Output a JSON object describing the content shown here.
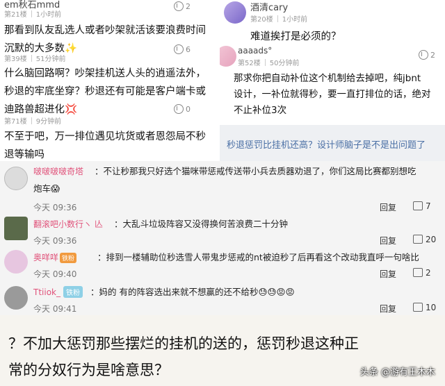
{
  "left_panel": {
    "comments": [
      {
        "username": "em秋石mmd",
        "floor": "第21楼",
        "time": "1小时前",
        "likes": "2",
        "lines": [
          "那看到队友乱选人或者吵架就活该要浪费时间",
          "沉默的大多数✨"
        ]
      },
      {
        "username": "",
        "floor": "第39楼",
        "time": "51分钟前",
        "likes": "6",
        "lines": [
          "什么脑回路啊？吵架挂机送人头的逍遥法外，",
          "秒退的牢底坐穿？秒退还有可能是客户端卡或",
          "迪路兽超进化💢"
        ]
      },
      {
        "username": "",
        "floor": "第71楼",
        "time": "9分钟前",
        "likes": "0",
        "lines": [
          "不至于吧，万一排位遇见坑货或者恩怨局不秒",
          "退等输吗"
        ]
      }
    ]
  },
  "right_panel": {
    "comments": [
      {
        "username": "酒清cary",
        "floor": "第20楼",
        "time": "1小时前",
        "likes": "",
        "lines": [
          "难道挨打是必须的？"
        ]
      },
      {
        "username": "aaaads°",
        "floor": "第52楼",
        "time": "50分钟前",
        "likes": "2",
        "lines": [
          "那求你把自动补位这个机制给去掉吧，纯jbnt",
          "设计，一补位就得秒，要一直打排位的话，绝对",
          "不止补位3次"
        ]
      }
    ],
    "strip_text": "秒退惩罚比挂机还高？设计师脑子是不是出问题了"
  },
  "bottom_panel": {
    "reply_label": "回复",
    "comments": [
      {
        "name": "啵啵啵啵奇塔",
        "badge": "",
        "text": [
          "：不让秒那我只好选个猫咪带惩戒传送带小兵去质器劝退了，你们这局比赛都别想吃",
          "炮车😱"
        ],
        "time": "今天 09:36",
        "likes": "7",
        "avatar_color": "#d9d9d9"
      },
      {
        "name": "翻滚吧小数行ヽ 亾",
        "badge": "",
        "text": [
          "：大乱斗垃圾阵容又没得换何苦浪费二十分钟"
        ],
        "time": "今天 09:36",
        "likes": "20",
        "avatar_color": "#5a6a4a"
      },
      {
        "name": "奥咩咩",
        "badge": "铁粉",
        "text": [
          "：排到一楼辅助位秒选雪人带鬼步惩戒的nt被迫秒了后再看这个改动我直呼一句啥比"
        ],
        "time": "今天 09:40",
        "likes": "2",
        "avatar_color": "#e7c6e0"
      },
      {
        "name": "Ttiiok_",
        "badge": "铁粉",
        "text": [
          "：妈的 有的阵容选出来就不想赢的还不给秒😓😓😡😡"
        ],
        "time": "今天 09:41",
        "likes": "10",
        "avatar_color": "#9a9a9a"
      }
    ]
  },
  "banner": {
    "lines": [
      "？不加大惩罚那些摆烂的挂机的送的，惩罚秒退这种正",
      "常的分奴行为是啥意思？"
    ],
    "watermark": "头条 @游有王木木"
  }
}
